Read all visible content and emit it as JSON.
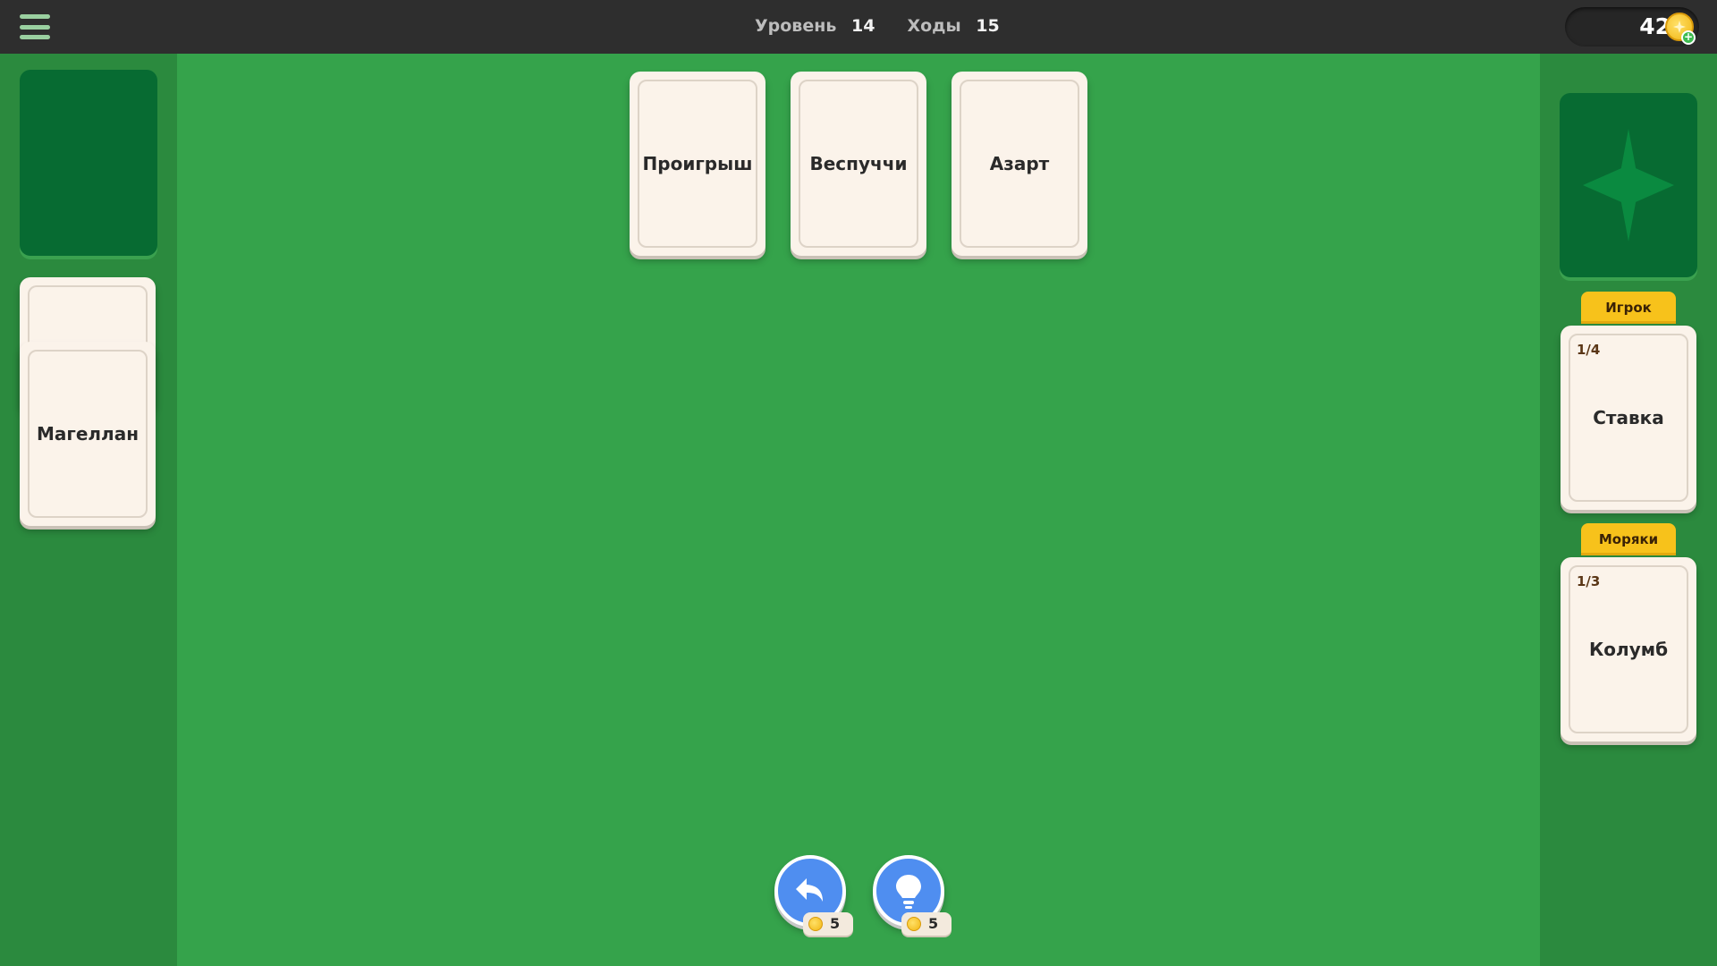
{
  "header": {
    "level_label": "Уровень",
    "level_value": "14",
    "moves_label": "Ходы",
    "moves_value": "15",
    "coins": "42"
  },
  "tableau": {
    "cards": [
      "Проигрыш",
      "Веспуччи",
      "Азарт"
    ]
  },
  "waste": {
    "top_card": "Магеллан"
  },
  "foundations": [
    {
      "category": "Игрок",
      "progress": "1/4",
      "card": "Ставка"
    },
    {
      "category": "Моряки",
      "progress": "1/3",
      "card": "Колумб"
    }
  ],
  "actions": {
    "undo_cost": "5",
    "hint_cost": "5"
  },
  "colors": {
    "felt": "#35a34b",
    "side_panel": "#2b8a3e",
    "top_bar": "#2e2e2e",
    "card_face": "#fbf3ea",
    "card_back": "#076b32",
    "tag_yellow": "#f7c21b",
    "button_blue": "#4f8ef0"
  },
  "icons": [
    "hamburger-menu-icon",
    "coin-icon",
    "plus-icon",
    "undo-arrow-icon",
    "lightbulb-icon",
    "star-icon"
  ]
}
